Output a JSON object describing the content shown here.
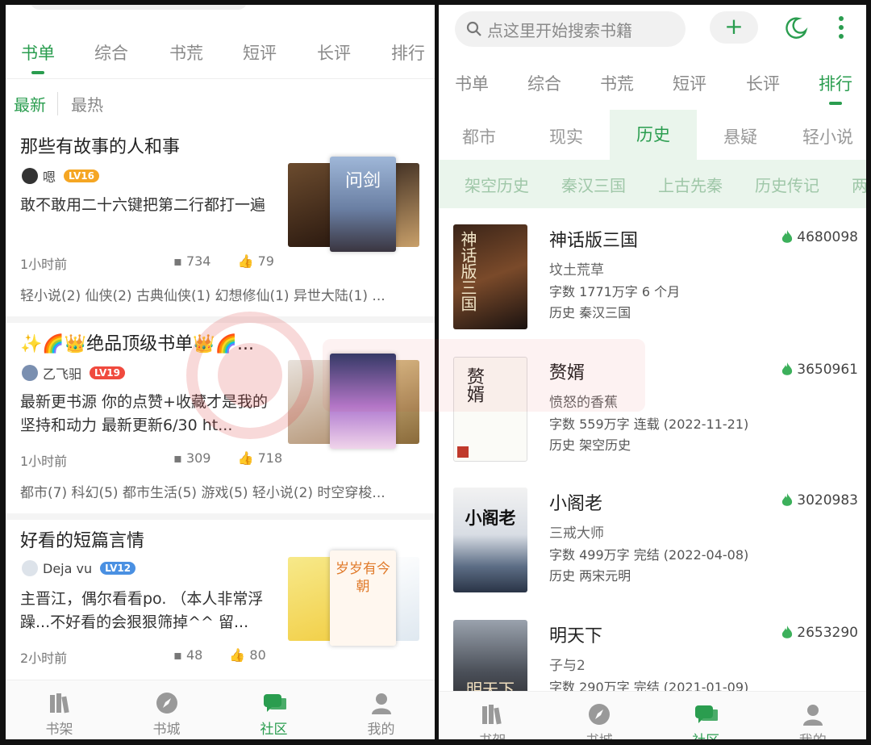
{
  "left": {
    "tabs": [
      {
        "label": "书单",
        "active": true
      },
      {
        "label": "综合"
      },
      {
        "label": "书荒"
      },
      {
        "label": "短评"
      },
      {
        "label": "长评"
      },
      {
        "label": "排行"
      }
    ],
    "subtabs": {
      "active": "最新",
      "inactive": "最热"
    },
    "cards": [
      {
        "title": "那些有故事的人和事",
        "author": "嗯",
        "level": "LV16",
        "level_color": "#f5a623",
        "description": "敢不敢用二十六键把第二行都打一遍",
        "time": "1小时前",
        "comments": "734",
        "likes": "79",
        "tags": "轻小说(2) 仙侠(2) 古典仙侠(1) 幻想修仙(1) 异世大陆(1) ..."
      },
      {
        "title": "✨🌈👑绝品顶级书单👑🌈...",
        "author": "乙飞驲",
        "level": "LV19",
        "level_color": "#f04a3e",
        "description": "最新更书源 你的点赞+收藏才是我的坚持和动力 最新更新6/30 ht...",
        "time": "1小时前",
        "comments": "309",
        "likes": "718",
        "tags": "都市(7) 科幻(5) 都市生活(5) 游戏(5) 轻小说(2) 时空穿梭..."
      },
      {
        "title": "好看的短篇言情",
        "author": "Deja vu",
        "level": "LV12",
        "level_color": "#4a90e2",
        "description": "主晋江，偶尔看看po. （本人非常浮躁...不好看的会狠狠筛掉^^ 留...",
        "time": "2小时前",
        "comments": "48",
        "likes": "80",
        "tags": ""
      }
    ],
    "cover_texts": {
      "c1": "问剑",
      "c3": "岁岁有今朝"
    },
    "nav": [
      {
        "label": "书架",
        "icon": "bookshelf-icon"
      },
      {
        "label": "书城",
        "icon": "compass-icon"
      },
      {
        "label": "社区",
        "icon": "chat-icon",
        "active": true
      },
      {
        "label": "我的",
        "icon": "person-icon"
      }
    ]
  },
  "right": {
    "search_placeholder": "点这里开始搜索书籍",
    "plus_label": "+",
    "tabs": [
      {
        "label": "书单"
      },
      {
        "label": "综合"
      },
      {
        "label": "书荒"
      },
      {
        "label": "短评"
      },
      {
        "label": "长评"
      },
      {
        "label": "排行",
        "active": true
      }
    ],
    "categories": [
      "都市",
      "现实",
      "历史",
      "悬疑",
      "轻小说"
    ],
    "selected_category": "历史",
    "subcategories": [
      "架空历史",
      "秦汉三国",
      "上古先秦",
      "历史传记",
      "两"
    ],
    "books": [
      {
        "title": "神话版三国",
        "author": "坟土荒草",
        "info": "字数 1771万字  6 个月",
        "category": "历史 秦汉三国",
        "heat": "4680098",
        "cover_text": "神话版三国"
      },
      {
        "title": "赘婿",
        "author": "愤怒的香蕉",
        "info": "字数 559万字  连载 (2022-11-21)",
        "category": "历史 架空历史",
        "heat": "3650961",
        "cover_text": "赘婿"
      },
      {
        "title": "小阁老",
        "author": "三戒大师",
        "info": "字数 499万字  完结 (2022-04-08)",
        "category": "历史 两宋元明",
        "heat": "3020983",
        "cover_text": "小阁老"
      },
      {
        "title": "明天下",
        "author": "子与2",
        "info": "字数 290万字  完结 (2021-01-09)",
        "category": "",
        "heat": "2653290",
        "cover_text": "明天下"
      }
    ],
    "nav": [
      {
        "label": "书架",
        "icon": "bookshelf-icon"
      },
      {
        "label": "书城",
        "icon": "compass-icon"
      },
      {
        "label": "社区",
        "icon": "chat-icon",
        "active": true
      },
      {
        "label": "我的",
        "icon": "person-icon"
      }
    ]
  },
  "colors": {
    "accent": "#2a9d4f",
    "accent_light": "#eaf5ec",
    "fire": "#3cb05b"
  }
}
